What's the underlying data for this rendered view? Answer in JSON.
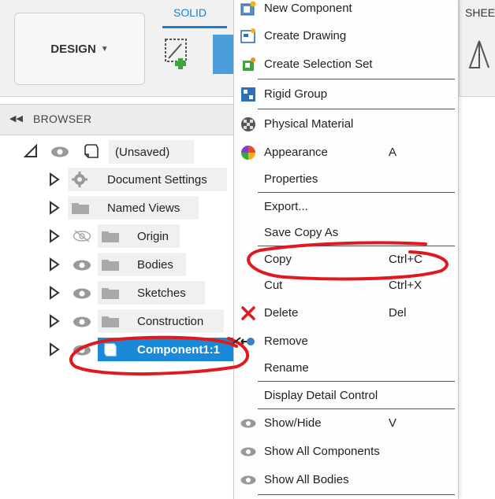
{
  "toolbar": {
    "design_label": "DESIGN",
    "solid_tab": "SOLID",
    "sheet_tab": "SHEE"
  },
  "browser": {
    "title": "BROWSER",
    "root_label": "(Unsaved)",
    "items": [
      {
        "label": "Document Settings"
      },
      {
        "label": "Named Views"
      },
      {
        "label": "Origin"
      },
      {
        "label": "Bodies"
      },
      {
        "label": "Sketches"
      },
      {
        "label": "Construction"
      },
      {
        "label": "Component1:1"
      }
    ]
  },
  "menu": {
    "items": [
      {
        "label": "New Component",
        "shortcut": ""
      },
      {
        "label": "Create Drawing",
        "shortcut": ""
      },
      {
        "label": "Create Selection Set",
        "shortcut": ""
      },
      {
        "label": "Rigid Group",
        "shortcut": ""
      },
      {
        "label": "Physical Material",
        "shortcut": ""
      },
      {
        "label": "Appearance",
        "shortcut": "A"
      },
      {
        "label": "Properties",
        "shortcut": ""
      },
      {
        "label": "Export...",
        "shortcut": ""
      },
      {
        "label": "Save Copy As",
        "shortcut": ""
      },
      {
        "label": "Copy",
        "shortcut": "Ctrl+C"
      },
      {
        "label": "Cut",
        "shortcut": "Ctrl+X"
      },
      {
        "label": "Delete",
        "shortcut": "Del"
      },
      {
        "label": "Remove",
        "shortcut": ""
      },
      {
        "label": "Rename",
        "shortcut": ""
      },
      {
        "label": "Display Detail Control",
        "shortcut": ""
      },
      {
        "label": "Show/Hide",
        "shortcut": "V"
      },
      {
        "label": "Show All Components",
        "shortcut": ""
      },
      {
        "label": "Show All Bodies",
        "shortcut": ""
      }
    ]
  },
  "colors": {
    "accent": "#1a7fd0",
    "selection": "#1a8ad8",
    "annotation": "#e0191f"
  }
}
